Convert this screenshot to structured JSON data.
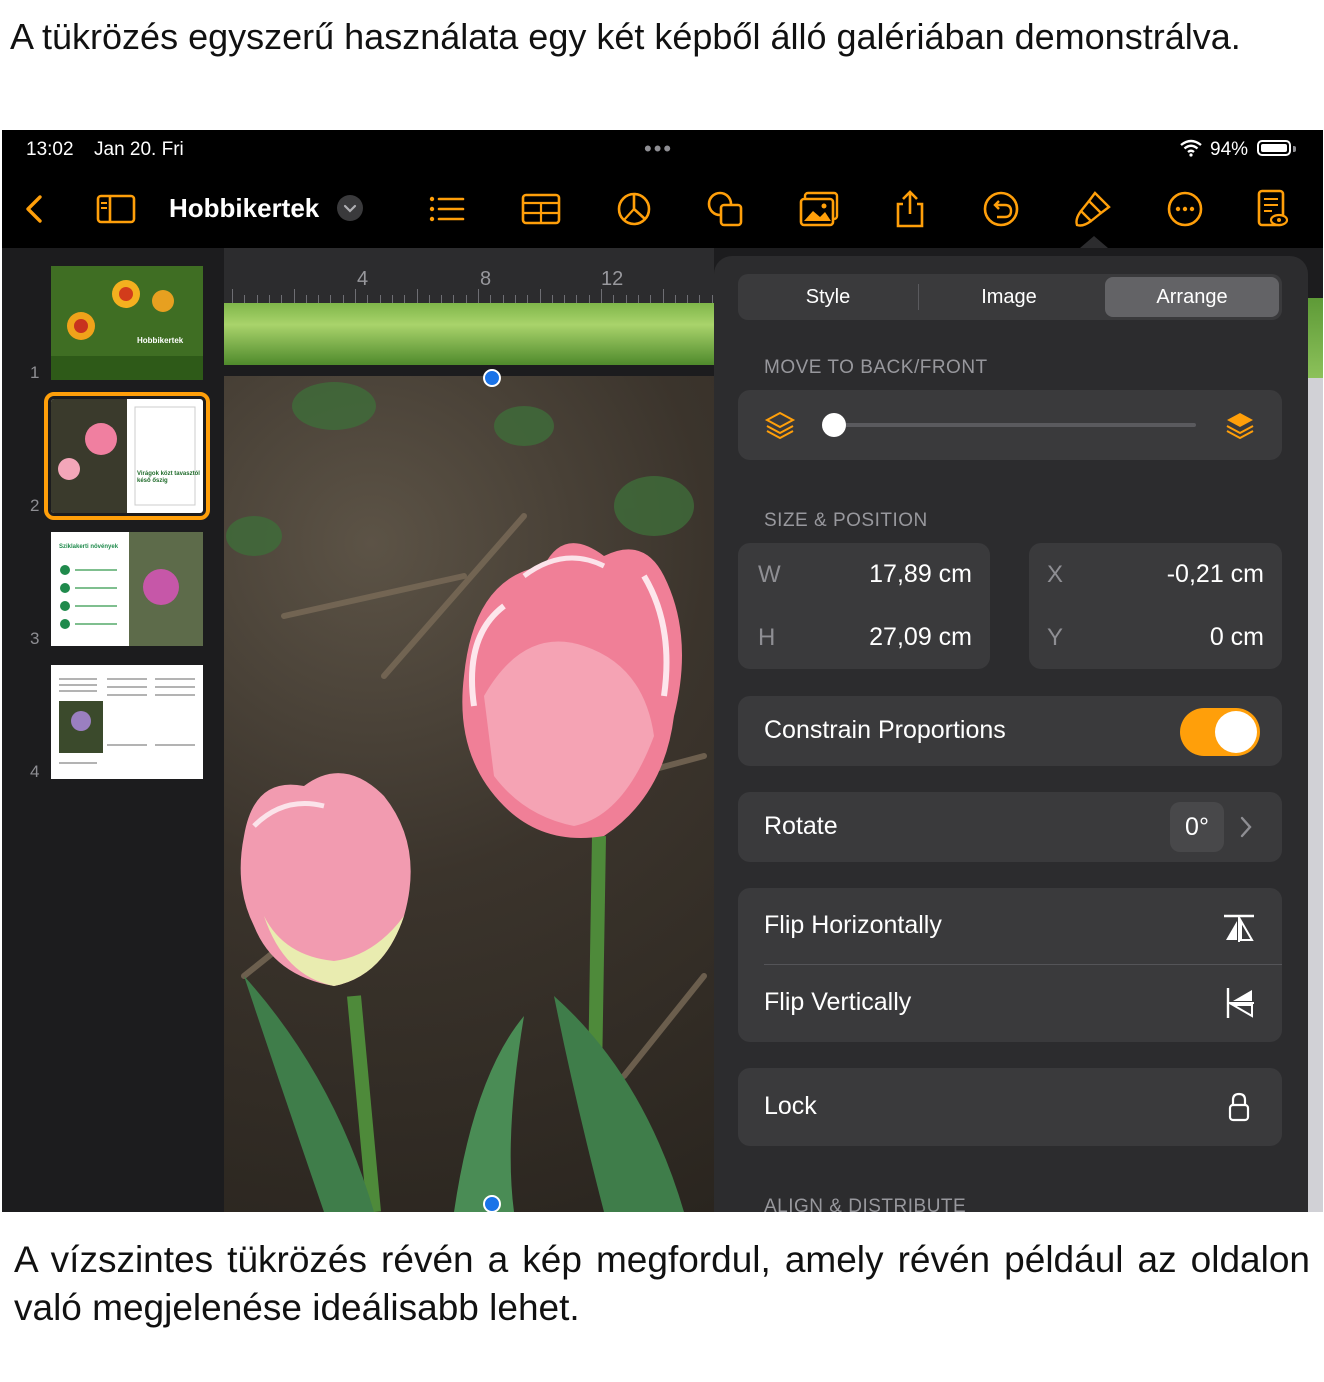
{
  "caption_top": "A tükrözés egyszerű használata egy két képből álló galériában demonstrálva.",
  "caption_bottom": "A vízszintes tükrözés révén a kép megfordul, amely révén például az oldalon való megjelenése ideálisabb lehet.",
  "status": {
    "time": "13:02",
    "date": "Jan 20. Fri",
    "dots": "•••",
    "battery_pct": "94%"
  },
  "toolbar": {
    "title": "Hobbikertek",
    "icons": [
      "back-chevron-icon",
      "sidebar-icon",
      "list-icon",
      "table-icon",
      "chart-icon",
      "shapes-icon",
      "media-icon",
      "share-icon",
      "undo-icon",
      "format-brush-icon",
      "more-icon",
      "reading-view-icon"
    ],
    "accent": "#ff9f0a"
  },
  "slides": [
    {
      "number": "1",
      "title": "Hobbikertek"
    },
    {
      "number": "2",
      "title": "Virágok közt tavasztól késő őszig"
    },
    {
      "number": "3",
      "title": "Sziklakerti növények"
    },
    {
      "number": "4"
    }
  ],
  "ruler": {
    "labels": [
      "4",
      "8",
      "12"
    ]
  },
  "panel": {
    "tabs": [
      "Style",
      "Image",
      "Arrange"
    ],
    "active_tab": "Arrange",
    "move_label": "MOVE TO BACK/FRONT",
    "move_level": 0,
    "size_label": "SIZE & POSITION",
    "w_key": "W",
    "w_val": "17,89 cm",
    "h_key": "H",
    "h_val": "27,09 cm",
    "x_key": "X",
    "x_val": "-0,21 cm",
    "y_key": "Y",
    "y_val": "0 cm",
    "constrain_label": "Constrain Proportions",
    "constrain_on": true,
    "rotate_label": "Rotate",
    "rotate_val": "0°",
    "flip_h": "Flip Horizontally",
    "flip_v": "Flip Vertically",
    "lock": "Lock",
    "align_label": "ALIGN & DISTRIBUTE"
  }
}
